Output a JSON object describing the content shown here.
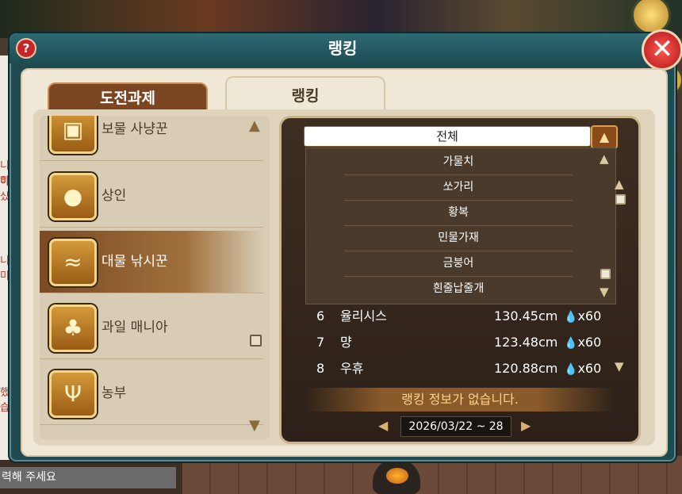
{
  "window": {
    "title": "랭킹",
    "help_label": "?",
    "close_label": "✕"
  },
  "tabs": [
    {
      "label": "도전과제",
      "active": false
    },
    {
      "label": "랭킹",
      "active": true
    }
  ],
  "categories": [
    {
      "label": "보물 사냥꾼",
      "icon": "treasure-chest-icon",
      "glyph": "▣",
      "selected": false
    },
    {
      "label": "상인",
      "icon": "money-bag-icon",
      "glyph": "●",
      "selected": false
    },
    {
      "label": "대물 낚시꾼",
      "icon": "fish-icon",
      "glyph": "≈",
      "selected": true
    },
    {
      "label": "과일 매니아",
      "icon": "fruit-icon",
      "glyph": "♣",
      "selected": false
    },
    {
      "label": "농부",
      "icon": "farmer-icon",
      "glyph": "Ψ",
      "selected": false
    }
  ],
  "dropdown": {
    "selected": "전체",
    "options": [
      "가물치",
      "쏘가리",
      "황복",
      "민물가재",
      "금붕어",
      "흰줄납줄개"
    ]
  },
  "rankings": [
    {
      "rank": "6",
      "name": "율리시스",
      "length": "130.45cm",
      "reward": "x60"
    },
    {
      "rank": "7",
      "name": "먕",
      "length": "123.48cm",
      "reward": "x60"
    },
    {
      "rank": "8",
      "name": "우휴",
      "length": "120.88cm",
      "reward": "x60"
    }
  ],
  "notice": "랭킹 정보가 없습니다.",
  "date_range": "2026/03/22 ~ 28",
  "chat": {
    "input_placeholder": "력해 주세요",
    "fragments": [
      "니미",
      "하싰",
      "니미",
      "했습"
    ]
  },
  "colors": {
    "accent": "#7a4520",
    "window_frame": "#1f4a52",
    "panel": "#f0e8d6",
    "close": "#c4262a"
  }
}
